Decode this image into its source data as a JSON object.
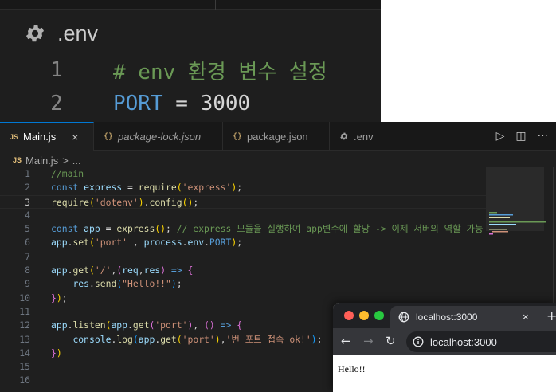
{
  "env_panel": {
    "title": ".env",
    "lines": [
      {
        "num": "1",
        "comment": "# env 환경 변수 설정"
      },
      {
        "num": "2",
        "key": "PORT",
        "op": "=",
        "value": "3000"
      }
    ]
  },
  "editor": {
    "tabs": [
      {
        "icon_text": "JS",
        "label": "Main.js",
        "active": true,
        "close": "×"
      },
      {
        "icon_text": "{}",
        "label": "package-lock.json"
      },
      {
        "icon_text": "{}",
        "label": "package.json"
      },
      {
        "icon": "gear-icon",
        "label": ".env"
      }
    ],
    "breadcrumb": {
      "icon_text": "JS",
      "file": "Main.js",
      "sep": ">",
      "rest": "..."
    },
    "line_numbers": [
      "1",
      "2",
      "3",
      "4",
      "5",
      "6",
      "7",
      "8",
      "9",
      "10",
      "11",
      "12",
      "13",
      "14",
      "15",
      "16"
    ],
    "current_line": "3",
    "code": {
      "l1": "//main",
      "l2_kw": "const",
      "l2_var": "express",
      "l2_fn": "require",
      "l2_str": "'express'",
      "l3_fn": "require",
      "l3_str": "'dotenv'",
      "l3_fn2": "config",
      "l5_kw": "const",
      "l5_var": "app",
      "l5_fn": "express",
      "l5_cmt": "// express 모듈을 실행하여 app변수에 할당 -> 이제 서버의 역할 가능",
      "l6_var": "app",
      "l6_fn": "set",
      "l6_str": "'port'",
      "l6_var2": "process",
      "l6_var3": "env",
      "l6_const": "PORT",
      "l8_var": "app",
      "l8_fn": "get",
      "l8_str": "'/'",
      "l8_p1": "req",
      "l8_p2": "res",
      "l9_var": "res",
      "l9_fn": "send",
      "l9_str": "\"Hello!!\"",
      "l12_var": "app",
      "l12_fn": "listen",
      "l12_var2": "app",
      "l12_fn2": "get",
      "l12_str": "'port'",
      "l13_var": "console",
      "l13_fn": "log",
      "l13_var2": "app",
      "l13_fn2": "get",
      "l13_str": "'port'",
      "l13_str2": "'번 포트 접속 ok!'"
    }
  },
  "browser": {
    "tab_title": "localhost:3000",
    "tab_close": "×",
    "new_tab": "+",
    "url": "localhost:3000",
    "page_text": "Hello!!"
  },
  "colors": {
    "editor_bg": "#1f1f1f",
    "keyword": "#569cd6",
    "function": "#dcdcaa",
    "string": "#ce9178",
    "comment": "#6a9955",
    "variable": "#9cdcfe",
    "traffic_red": "#ff5f57",
    "traffic_yellow": "#febc2e",
    "traffic_green": "#28c840"
  }
}
